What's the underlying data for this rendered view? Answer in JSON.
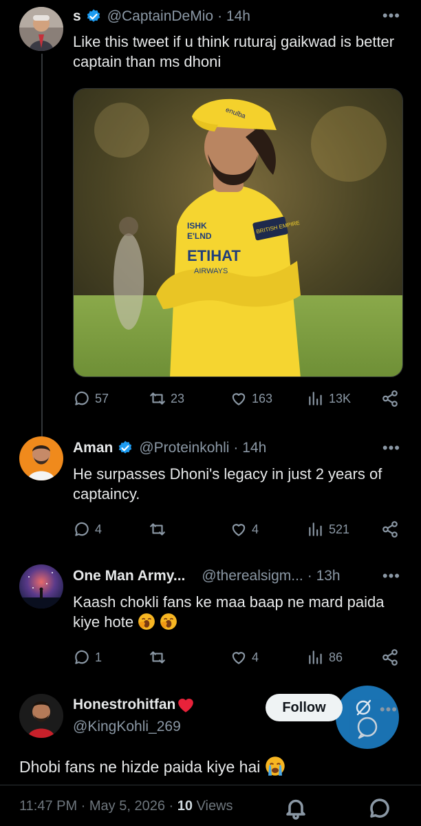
{
  "tweets": [
    {
      "name": "s",
      "handle": "@CaptainDeMio",
      "time": "· 14h",
      "text": "Like this tweet if u think ruturaj gaikwad is better captain than ms dhoni",
      "stats": {
        "replies": "57",
        "retweets": "23",
        "likes": "163",
        "views": "13K"
      },
      "media_text": [
        "ISHK",
        "E'LND",
        "ETIHAT",
        "AIRWAYS",
        "BRITISH EMPIRE",
        "enulba"
      ]
    },
    {
      "name": "Aman",
      "handle": "@Proteinkohli",
      "time": "· 14h",
      "text": "He surpasses Dhoni's legacy in just 2 years of captaincy.",
      "stats": {
        "replies": "4",
        "retweets": "",
        "likes": "4",
        "views": "521"
      }
    },
    {
      "name": "One Man Army...",
      "handle": "@therealsigm...",
      "time": "· 13h",
      "text": "Kaash chokli fans ke maa baap ne mard paida kiye hote",
      "stats": {
        "replies": "1",
        "retweets": "",
        "likes": "4",
        "views": "86"
      }
    }
  ],
  "profile": {
    "name": "Honestrohitfan",
    "handle": "@KingKohli_269",
    "follow_label": "Follow"
  },
  "main_post": {
    "text": "Dhobi fans ne hizde paida kiye hai",
    "time": "11:47 PM · May 5, 2026 ·",
    "views_count": "10",
    "views_label": "Views"
  },
  "colors": {
    "accent": "#1d9bf0",
    "muted": "#8b98a5",
    "background": "#000000",
    "heart": "#f91880"
  },
  "icons": [
    "verified-icon",
    "more-icon",
    "reply-icon",
    "retweet-icon",
    "like-icon",
    "views-icon",
    "share-icon",
    "compose-icon",
    "heart-emoji",
    "yawn-emoji",
    "crying-emoji"
  ]
}
